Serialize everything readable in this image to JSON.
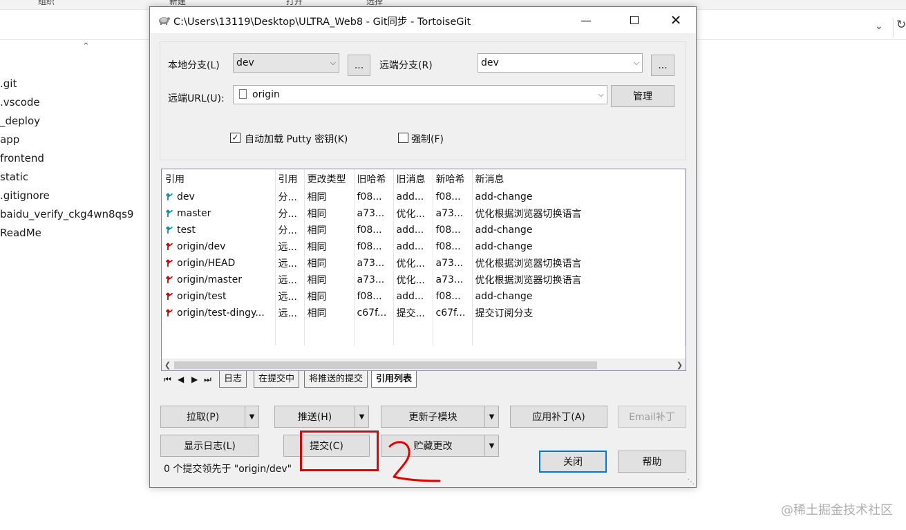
{
  "explorer": {
    "ribbon_labels": [
      "组织",
      "新建",
      "打开",
      "选择"
    ],
    "files": [
      ".git",
      ".vscode",
      "_deploy",
      "app",
      "frontend",
      "static",
      ".gitignore",
      "baidu_verify_ckg4wn8qs9",
      "ReadMe"
    ]
  },
  "dialog": {
    "title": "C:\\Users\\13119\\Desktop\\ULTRA_Web8 - Git同步 - TortoiseGit",
    "local_branch_label": "本地分支(L)",
    "local_branch_value": "dev",
    "remote_branch_label": "远端分支(R)",
    "remote_branch_value": "dev",
    "ellipsis_label": "...",
    "remote_url_label": "远端URL(U):",
    "remote_url_value": "origin",
    "manage_label": "管理",
    "autoload_putty_label": "自动加载 Putty 密钥(K)",
    "autoload_putty_checked": true,
    "force_label": "强制(F)",
    "force_checked": false,
    "refs_table": {
      "columns": [
        "引用",
        "引用",
        "更改类型",
        "旧哈希",
        "旧消息",
        "新哈希",
        "新消息"
      ],
      "rows": [
        {
          "ref": "dev",
          "ref_type": "分...",
          "change": "相同",
          "old_hash": "f08...",
          "old_msg": "add...",
          "new_hash": "f08...",
          "new_msg": "add-change",
          "remote": false
        },
        {
          "ref": "master",
          "ref_type": "分...",
          "change": "相同",
          "old_hash": "a73...",
          "old_msg": "优化...",
          "new_hash": "a73...",
          "new_msg": "优化根据浏览器切换语言",
          "remote": false
        },
        {
          "ref": "test",
          "ref_type": "分...",
          "change": "相同",
          "old_hash": "f08...",
          "old_msg": "add...",
          "new_hash": "f08...",
          "new_msg": "add-change",
          "remote": false
        },
        {
          "ref": "origin/dev",
          "ref_type": "远...",
          "change": "相同",
          "old_hash": "f08...",
          "old_msg": "add...",
          "new_hash": "f08...",
          "new_msg": "add-change",
          "remote": true
        },
        {
          "ref": "origin/HEAD",
          "ref_type": "远...",
          "change": "相同",
          "old_hash": "a73...",
          "old_msg": "优化...",
          "new_hash": "a73...",
          "new_msg": "优化根据浏览器切换语言",
          "remote": true
        },
        {
          "ref": "origin/master",
          "ref_type": "远...",
          "change": "相同",
          "old_hash": "a73...",
          "old_msg": "优化...",
          "new_hash": "a73...",
          "new_msg": "优化根据浏览器切换语言",
          "remote": true
        },
        {
          "ref": "origin/test",
          "ref_type": "远...",
          "change": "相同",
          "old_hash": "f08...",
          "old_msg": "add...",
          "new_hash": "f08...",
          "new_msg": "add-change",
          "remote": true
        },
        {
          "ref": "origin/test-dingy...",
          "ref_type": "远...",
          "change": "相同",
          "old_hash": "c67f...",
          "old_msg": "提交...",
          "new_hash": "c67f...",
          "new_msg": "提交订阅分支",
          "remote": true
        }
      ]
    },
    "tabs": [
      "日志",
      "在提交中",
      "将推送的提交",
      "引用列表"
    ],
    "active_tab": "引用列表",
    "buttons": {
      "pull": "拉取(P)",
      "push": "推送(H)",
      "update_submodules": "更新子模块",
      "apply_patch": "应用补丁(A)",
      "email_patch": "Email补丁",
      "show_log": "显示日志(L)",
      "commit": "提交(C)",
      "stash": "贮藏更改",
      "close": "关闭",
      "help": "帮助"
    },
    "status_text": "0 个提交领先于 \"origin/dev\""
  },
  "watermark": "@稀土掘金技术社区",
  "colors": {
    "annotation_red": "#e30000",
    "default_button_border": "#0078d7",
    "local_ref_icon": "#1a8c9c",
    "remote_ref_icon": "#b01010"
  }
}
